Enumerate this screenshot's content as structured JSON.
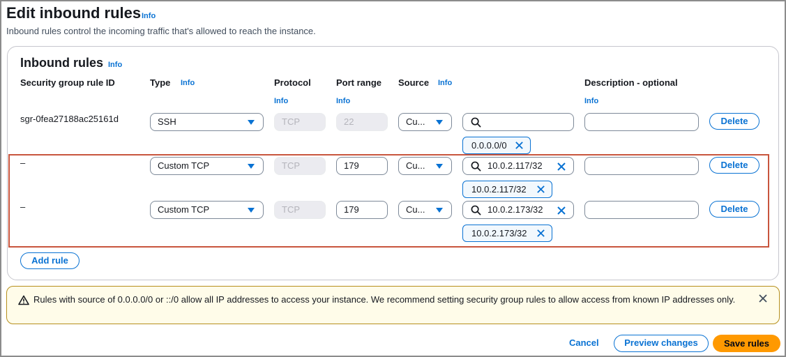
{
  "page": {
    "title": "Edit inbound rules",
    "title_info": "Info",
    "description": "Inbound rules control the incoming traffic that's allowed to reach the instance."
  },
  "section": {
    "title": "Inbound rules",
    "title_info": "Info"
  },
  "columns": {
    "rule_id": "Security group rule ID",
    "type": "Type",
    "type_info": "Info",
    "protocol": "Protocol",
    "protocol_info": "Info",
    "port_range": "Port range",
    "port_range_info": "Info",
    "source": "Source",
    "source_info": "Info",
    "description": "Description - optional",
    "description_info": "Info"
  },
  "rules": [
    {
      "rule_id": "sgr-0fea27188ac25161d",
      "type": "SSH",
      "protocol": "TCP",
      "port_range": "22",
      "source_type": "Cu...",
      "source_search": "",
      "token": "0.0.0.0/0",
      "description": "",
      "delete_label": "Delete"
    },
    {
      "rule_id": "–",
      "type": "Custom TCP",
      "protocol": "TCP",
      "port_range": "179",
      "source_type": "Cu...",
      "source_search": "10.0.2.117/32",
      "token": "10.0.2.117/32",
      "description": "",
      "delete_label": "Delete"
    },
    {
      "rule_id": "–",
      "type": "Custom TCP",
      "protocol": "TCP",
      "port_range": "179",
      "source_type": "Cu...",
      "source_search": "10.0.2.173/32",
      "token": "10.0.2.173/32",
      "description": "",
      "delete_label": "Delete"
    }
  ],
  "add_rule_label": "Add rule",
  "alert": {
    "message": "Rules with source of 0.0.0.0/0 or ::/0 allow all IP addresses to access your instance. We recommend setting security group rules to allow access from known IP addresses only."
  },
  "footer": {
    "cancel_label": "Cancel",
    "preview_label": "Preview changes",
    "save_label": "Save rules"
  },
  "colors": {
    "accent": "#0972d3",
    "primary_button": "#ff9900",
    "highlight_border": "#c8553d",
    "warning_bg": "#fffce9"
  }
}
